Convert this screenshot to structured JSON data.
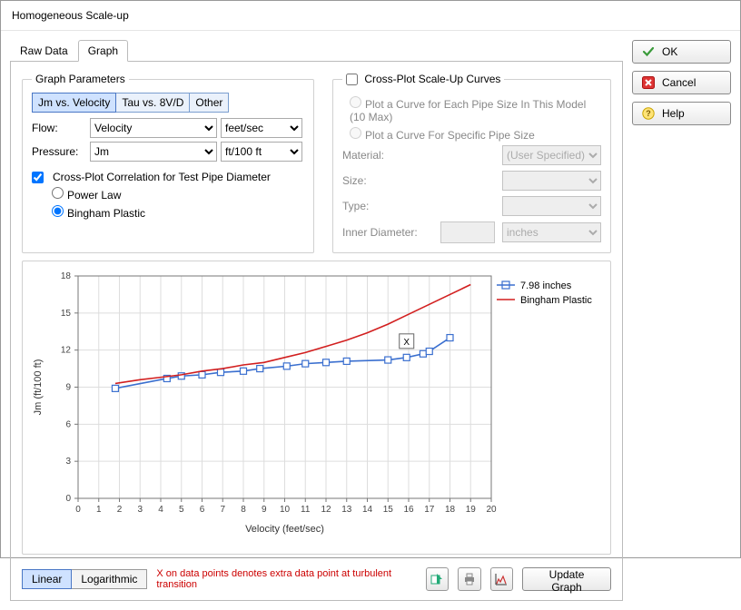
{
  "window": {
    "title": "Homogeneous Scale-up"
  },
  "tabs": {
    "raw_data": "Raw Data",
    "graph": "Graph"
  },
  "graph_params": {
    "legend": "Graph Parameters",
    "buttons": {
      "jm_vs_velocity": "Jm vs. Velocity",
      "tau_vs_8vd": "Tau vs. 8V/D",
      "other": "Other"
    },
    "flow_label": "Flow:",
    "flow_value": "Velocity",
    "flow_unit": "feet/sec",
    "pressure_label": "Pressure:",
    "pressure_value": "Jm",
    "pressure_unit": "ft/100 ft"
  },
  "corr": {
    "checkbox": "Cross-Plot Correlation for Test Pipe Diameter",
    "power_law": "Power Law",
    "bingham": "Bingham Plastic"
  },
  "crossplot": {
    "legend": "Cross-Plot Scale-Up Curves",
    "opt_each": "Plot a Curve for Each Pipe Size In This Model (10 Max)",
    "opt_specific": "Plot a Curve For Specific Pipe Size",
    "material_label": "Material:",
    "material_value": "(User Specified)",
    "size_label": "Size:",
    "type_label": "Type:",
    "inner_diam_label": "Inner Diameter:",
    "inner_diam_unit": "inches"
  },
  "chart": {
    "xlabel": "Velocity (feet/sec)",
    "ylabel": "Jm (ft/100 ft)",
    "legend_series": "7.98 inches",
    "legend_corr": "Bingham Plastic",
    "x_annot": "X"
  },
  "chart_data": {
    "type": "line",
    "xlabel": "Velocity (feet/sec)",
    "ylabel": "Jm (ft/100 ft)",
    "xlim": [
      0,
      20
    ],
    "ylim": [
      0,
      18
    ],
    "xticks": [
      0,
      1,
      2,
      3,
      4,
      5,
      6,
      7,
      8,
      9,
      10,
      11,
      12,
      13,
      14,
      15,
      16,
      17,
      18,
      19,
      20
    ],
    "yticks": [
      0,
      3,
      6,
      9,
      12,
      15,
      18
    ],
    "series": [
      {
        "name": "7.98 inches",
        "style": "markers+line",
        "color": "#3a6fcf",
        "x": [
          1.8,
          4.3,
          5.0,
          6.0,
          6.9,
          8.0,
          8.8,
          10.1,
          11.0,
          12.0,
          13.0,
          15.0,
          15.9,
          16.7,
          17.0,
          18.0
        ],
        "y": [
          8.9,
          9.7,
          9.9,
          10.0,
          10.2,
          10.3,
          10.5,
          10.7,
          10.9,
          11.0,
          11.1,
          11.2,
          11.4,
          11.7,
          11.9,
          13.0
        ],
        "annotation": {
          "label": "X",
          "x": 15.9,
          "y": 11.4,
          "meaning": "extra data point at turbulent transition"
        }
      },
      {
        "name": "Bingham Plastic",
        "style": "line",
        "color": "#d21f1f",
        "x": [
          1.8,
          3,
          4,
          5,
          6,
          7,
          8,
          9,
          10,
          11,
          12,
          13,
          14,
          15,
          16,
          17,
          18,
          19
        ],
        "y": [
          9.3,
          9.6,
          9.8,
          10.0,
          10.3,
          10.5,
          10.8,
          11.0,
          11.4,
          11.8,
          12.3,
          12.8,
          13.4,
          14.1,
          14.9,
          15.7,
          16.5,
          17.3
        ]
      }
    ]
  },
  "bottom": {
    "linear": "Linear",
    "log": "Logarithmic",
    "note": "X on data points denotes extra data point at turbulent transition",
    "update": "Update Graph"
  },
  "side": {
    "ok": "OK",
    "cancel": "Cancel",
    "help": "Help"
  }
}
